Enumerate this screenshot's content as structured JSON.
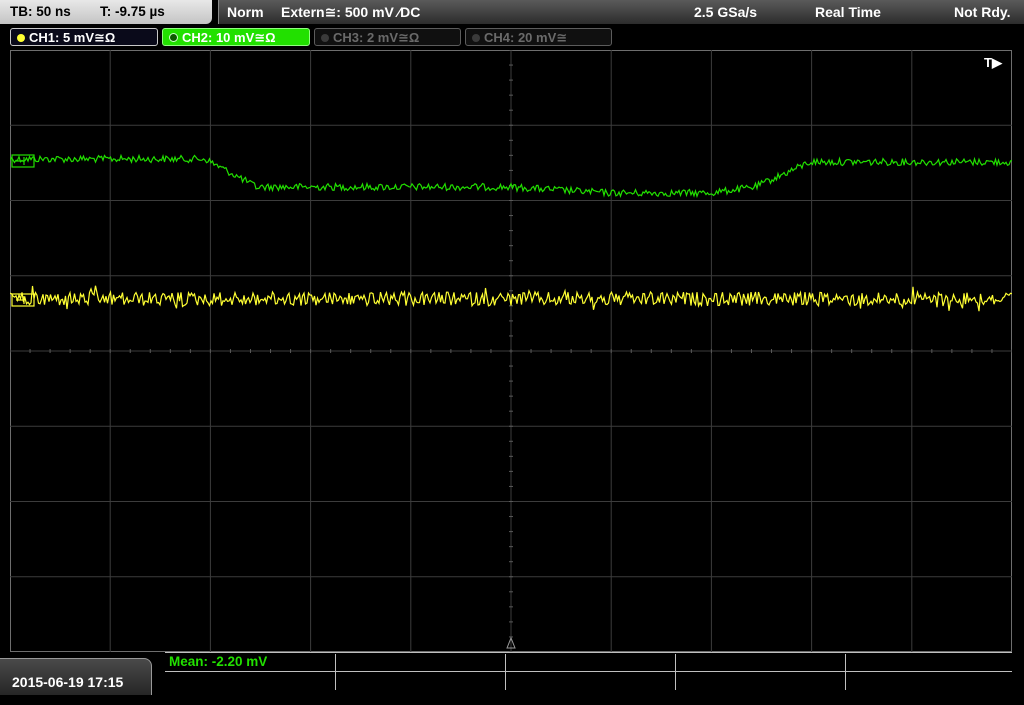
{
  "timebase": {
    "tb": "TB: 50 ns",
    "trigger_time": "T: -9.75 µs"
  },
  "status": {
    "mode": "Norm",
    "trigger": "Extern≅: 500 mV ⁄DC",
    "sample_rate": "2.5 GSa/s",
    "acq_mode": "Real Time",
    "state": "Not Rdy."
  },
  "channels": [
    {
      "label": "CH1: 5 mV≅Ω",
      "color": "#ffff33",
      "active": true
    },
    {
      "label": "CH2: 10 mV≅Ω",
      "color": "#22e000",
      "active": true,
      "selected": true
    },
    {
      "label": "CH3: 2 mV≅Ω",
      "color": "#6a6a6a",
      "active": false
    },
    {
      "label": "CH4: 20 mV≅",
      "color": "#6a6a6a",
      "active": false
    }
  ],
  "trigger_marker": "T▶",
  "datetime": "2015-06-19 17:15",
  "measurement": {
    "mean": "Mean: -2.20 mV"
  },
  "colors": {
    "ch1": "#ffff33",
    "ch2": "#22e000",
    "grid": "#3c3c3c"
  }
}
